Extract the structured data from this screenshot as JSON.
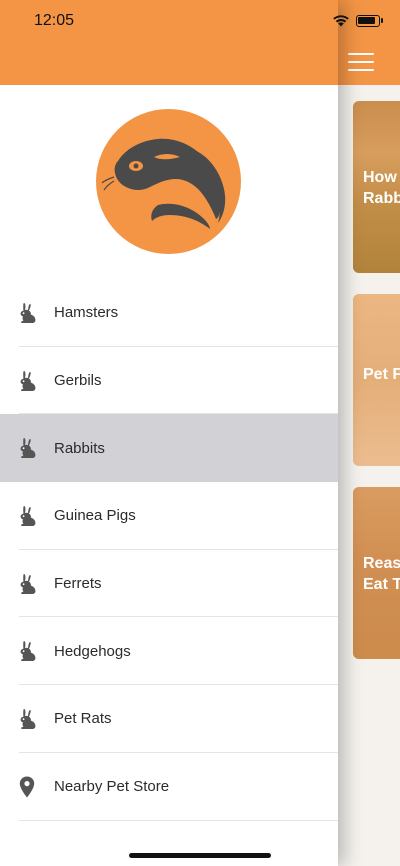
{
  "status": {
    "time": "12:05"
  },
  "content": {
    "cards": [
      {
        "text": "How\nRabb"
      },
      {
        "text": "Pet F"
      },
      {
        "text": "Reas\nEat T"
      }
    ]
  },
  "menu": {
    "items": [
      {
        "label": "Hamsters",
        "icon": "rabbit-icon",
        "selected": false
      },
      {
        "label": "Gerbils",
        "icon": "rabbit-icon",
        "selected": false
      },
      {
        "label": "Rabbits",
        "icon": "rabbit-icon",
        "selected": true
      },
      {
        "label": "Guinea Pigs",
        "icon": "rabbit-icon",
        "selected": false
      },
      {
        "label": "Ferrets",
        "icon": "rabbit-icon",
        "selected": false
      },
      {
        "label": "Hedgehogs",
        "icon": "rabbit-icon",
        "selected": false
      },
      {
        "label": "Pet Rats",
        "icon": "rabbit-icon",
        "selected": false
      },
      {
        "label": "Nearby Pet Store",
        "icon": "location-pin-icon",
        "selected": false
      }
    ]
  },
  "colors": {
    "accent": "#f39545",
    "selected_bg": "#d1d1d6",
    "icon": "#555555"
  }
}
